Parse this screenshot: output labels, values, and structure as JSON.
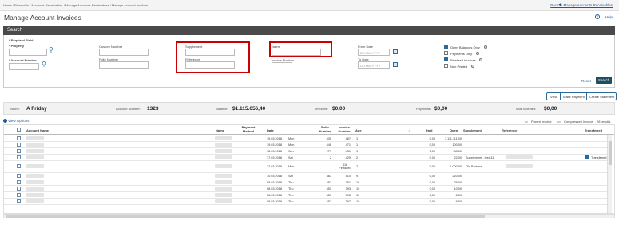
{
  "breadcrumb": "Home / Financials / Accounts Receivables / Manage Accounts Receivables / Manage Account Invoices",
  "back_link": "Back to Manage Accounts Receivables",
  "page_title": "Manage Account Invoices",
  "help": "Help",
  "search": {
    "header": "Search",
    "required_field": "* Required Field",
    "property_label": "* Property",
    "account_number_label": "* Account Number",
    "custom_number_label": "Custom Number",
    "folio_number_label": "Folio Number",
    "supplement_label": "Supplement",
    "reference_label": "Reference",
    "name_label": "Name",
    "invoice_number_label": "Invoice Number",
    "from_date_label": "From Date",
    "to_date_label": "To Date",
    "date_placeholder": "DD.MM.YYYY",
    "checks": [
      {
        "label": "Open Balances Only",
        "checked": true
      },
      {
        "label": "Payments Only",
        "checked": false
      },
      {
        "label": "Finalized Invoices",
        "checked": true
      },
      {
        "label": "Non Printed",
        "checked": false
      }
    ],
    "reset": "Reset",
    "search_button": "Search"
  },
  "actions": {
    "view": "View",
    "make_payment": "Make Payment",
    "create_statement": "Create Statement"
  },
  "summary": {
    "name_label": "Name:",
    "name_value": "A Friday",
    "account_number_label": "Account Number:",
    "account_number_value": "1323",
    "balance_label": "Balance:",
    "balance_value": "$1.115.656,40",
    "invoices_label": "Invoices:",
    "invoices_value": "$0,00",
    "payments_label": "Payments:",
    "payments_value": "$0,00",
    "total_selected_label": "Total Selected:",
    "total_selected_value": "$0,00"
  },
  "view_options": "View Options",
  "parent_invoice": "Parent Invoice",
  "compressed_invoice": "Compressed Invoice",
  "results": "28 results",
  "columns": {
    "account_name": "Account Name",
    "name": "Name",
    "payment_method": "Payment Method",
    "date": "Date",
    "folio_number": "Folio Number",
    "invoice_number": "Invoice Number",
    "age": "Age",
    "sort": "↓",
    "paid": "Paid",
    "open": "Open",
    "supplement": "Supplement",
    "reference": "Reference",
    "transferred": "Transferred"
  },
  "rows": [
    {
      "pm": "",
      "date": "19.03.2018",
      "day": "Mon",
      "folio": "435",
      "inv": "487",
      "age": "1",
      "paid": "0,00",
      "open": "1.111.111,00",
      "supp": "",
      "transferred": ""
    },
    {
      "pm": "",
      "date": "19.03.2018",
      "day": "Mon",
      "folio": "448",
      "inv": "471",
      "age": "1",
      "paid": "0,00",
      "open": "100,00",
      "supp": "",
      "transferred": ""
    },
    {
      "pm": "",
      "date": "18.03.2018",
      "day": "Sun",
      "folio": "279",
      "inv": "431",
      "age": "1",
      "paid": "0,00",
      "open": "-33,00",
      "supp": "",
      "transferred": ""
    },
    {
      "pm": "-",
      "date": "17.03.2018",
      "day": "Sat",
      "folio": "2",
      "inv": "429",
      "age": "2",
      "paid": "0,00",
      "open": "22,00",
      "supp": "Supplement - test111",
      "transferred": "Transferred"
    },
    {
      "pm": "",
      "date": "12.03.2018",
      "day": "Mon",
      "folio": "",
      "inv": "418 Finalized",
      "age": "7",
      "paid": "0,00",
      "open": "1.000,00",
      "supp": "Old Balance",
      "transferred": ""
    },
    {
      "pm": "",
      "date": "10.03.2018",
      "day": "Sat",
      "folio": "387",
      "inv": "410",
      "age": "9",
      "paid": "0,00",
      "open": "220,00",
      "supp": "",
      "transferred": ""
    },
    {
      "pm": "",
      "date": "08.03.2018",
      "day": "Thu",
      "folio": "457",
      "inv": "391",
      "age": "10",
      "paid": "0,00",
      "open": "25,00",
      "supp": "",
      "transferred": ""
    },
    {
      "pm": "",
      "date": "08.03.2018",
      "day": "Thu",
      "folio": "451",
      "inv": "393",
      "age": "10",
      "paid": "0,00",
      "open": "10,00",
      "supp": "",
      "transferred": ""
    },
    {
      "pm": "",
      "date": "08.03.2018",
      "day": "Thu",
      "folio": "453",
      "inv": "398",
      "age": "10",
      "paid": "0,00",
      "open": "8,00",
      "supp": "",
      "transferred": ""
    },
    {
      "pm": "",
      "date": "08.03.2018",
      "day": "Thu",
      "folio": "452",
      "inv": "397",
      "age": "10",
      "paid": "0,00",
      "open": "9,00",
      "supp": "",
      "transferred": ""
    }
  ],
  "colors": {
    "accent": "#1f4e5f",
    "link": "#1a5a9a",
    "highlight": "#cc0000",
    "header_bg": "#4a4a4a"
  }
}
